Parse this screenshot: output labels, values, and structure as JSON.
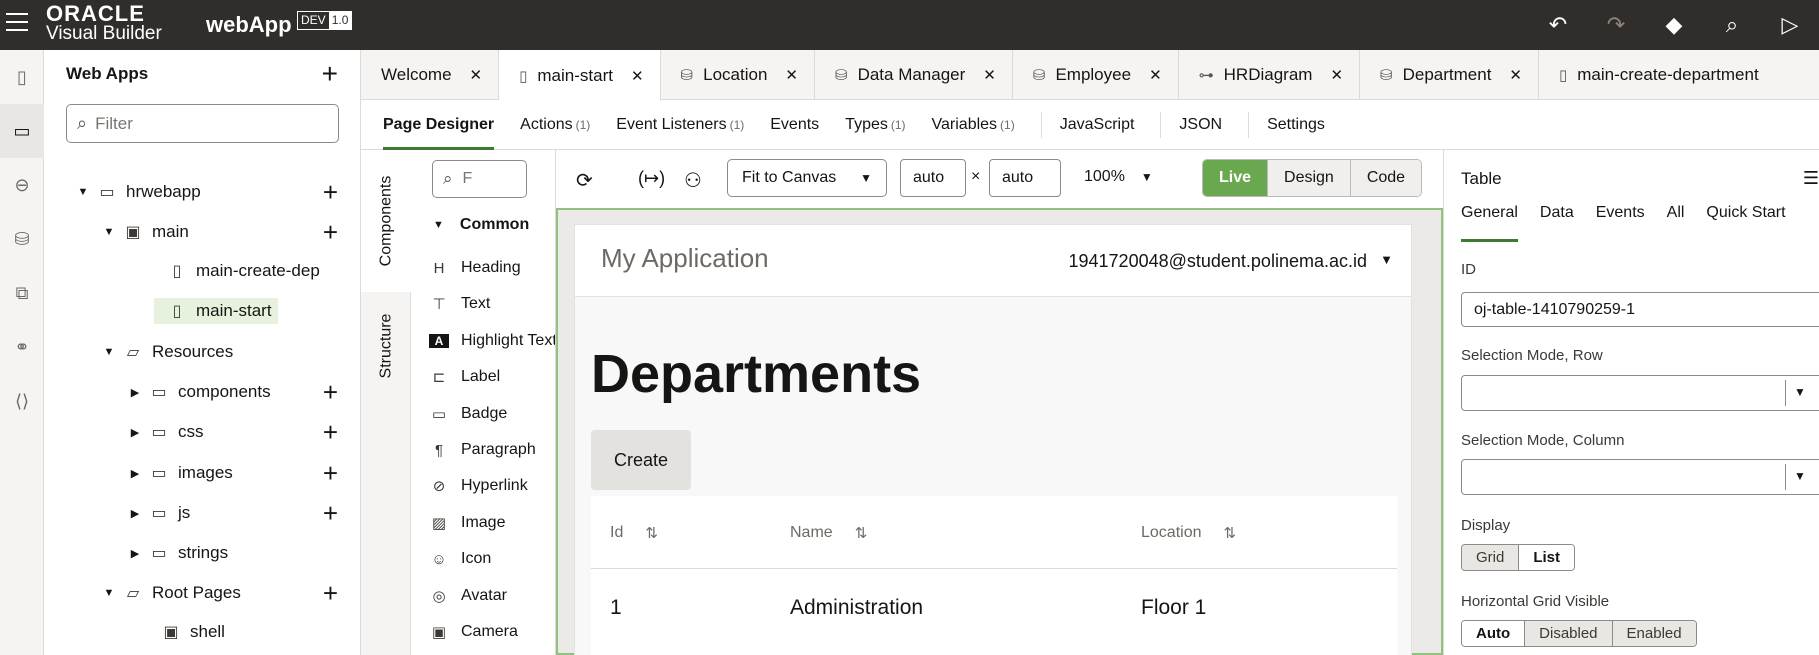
{
  "topbar": {
    "logo_top": "ORACLE",
    "logo_bottom": "Visual Builder",
    "app_name": "webApp",
    "env": "DEV",
    "version": "1.0",
    "icons": [
      "undo-icon",
      "redo-icon",
      "git-icon",
      "search-icon",
      "run-icon"
    ]
  },
  "rail": {
    "icons": [
      "mobile-apps-icon",
      "web-apps-icon",
      "services-icon",
      "business-objects-icon",
      "components-icon",
      "processes-icon",
      "source-icon"
    ],
    "active_index": 1
  },
  "navigator": {
    "title": "Web Apps",
    "filter_placeholder": "Filter",
    "tree": [
      {
        "label": "hrwebapp",
        "depth": 0,
        "expanded": true,
        "icon": "monitor-icon",
        "add": true
      },
      {
        "label": "main",
        "depth": 1,
        "expanded": true,
        "icon": "flow-icon",
        "add": true
      },
      {
        "label": "main-create-dep",
        "depth": 2,
        "icon": "page-icon",
        "add": false
      },
      {
        "label": "main-start",
        "depth": 2,
        "icon": "page-icon",
        "add": false,
        "selected": true
      },
      {
        "label": "Resources",
        "depth": 1,
        "expanded": true,
        "icon": "folder-open-icon",
        "add": false
      },
      {
        "label": "components",
        "depth": 2,
        "expanded": false,
        "icon": "folder-icon",
        "add": true
      },
      {
        "label": "css",
        "depth": 2,
        "expanded": false,
        "icon": "folder-icon",
        "add": true
      },
      {
        "label": "images",
        "depth": 2,
        "expanded": false,
        "icon": "folder-icon",
        "add": true
      },
      {
        "label": "js",
        "depth": 2,
        "expanded": false,
        "icon": "folder-icon",
        "add": true
      },
      {
        "label": "strings",
        "depth": 2,
        "expanded": false,
        "icon": "folder-icon",
        "add": false
      },
      {
        "label": "Root Pages",
        "depth": 1,
        "expanded": true,
        "icon": "folder-open-icon",
        "add": true
      },
      {
        "label": "shell",
        "depth": 2,
        "icon": "shell-icon",
        "add": false
      }
    ]
  },
  "tabs": [
    {
      "label": "Welcome",
      "icon": ""
    },
    {
      "label": "main-start",
      "icon": "page-icon",
      "active": true
    },
    {
      "label": "Location",
      "icon": "database-icon"
    },
    {
      "label": "Data Manager",
      "icon": "database-icon"
    },
    {
      "label": "Employee",
      "icon": "database-icon"
    },
    {
      "label": "HRDiagram",
      "icon": "diagram-icon"
    },
    {
      "label": "Department",
      "icon": "database-icon"
    },
    {
      "label": "main-create-department",
      "icon": "page-icon"
    }
  ],
  "subtabs": [
    {
      "label": "Page Designer",
      "count": "",
      "active": true
    },
    {
      "label": "Actions",
      "count": "(1)"
    },
    {
      "label": "Event Listeners",
      "count": "(1)"
    },
    {
      "label": "Events",
      "count": ""
    },
    {
      "label": "Types",
      "count": "(1)"
    },
    {
      "label": "Variables",
      "count": "(1)"
    },
    {
      "label": "JavaScript",
      "count": ""
    },
    {
      "label": "JSON",
      "count": ""
    },
    {
      "label": "Settings",
      "count": ""
    }
  ],
  "side_tabs": {
    "components": "Components",
    "structure": "Structure"
  },
  "palette": {
    "search_placeholder": "F",
    "category": "Common",
    "items": [
      {
        "label": "Heading",
        "icon": "heading-icon"
      },
      {
        "label": "Text",
        "icon": "text-icon"
      },
      {
        "label": "Highlight Text",
        "icon": "highlight-text-icon"
      },
      {
        "label": "Label",
        "icon": "label-icon"
      },
      {
        "label": "Badge",
        "icon": "badge-icon"
      },
      {
        "label": "Paragraph",
        "icon": "paragraph-icon"
      },
      {
        "label": "Hyperlink",
        "icon": "hyperlink-icon"
      },
      {
        "label": "Image",
        "icon": "image-icon"
      },
      {
        "label": "Icon",
        "icon": "icon-icon"
      },
      {
        "label": "Avatar",
        "icon": "avatar-icon"
      },
      {
        "label": "Camera",
        "icon": "camera-icon"
      }
    ]
  },
  "toolbar": {
    "fit": "Fit to Canvas",
    "width": "auto",
    "height": "auto",
    "times": "×",
    "zoom": "100%",
    "modes": [
      "Live",
      "Design",
      "Code"
    ],
    "active_mode": "Live"
  },
  "canvas": {
    "app_title": "My Application",
    "user": "1941720048@student.polinema.ac.id",
    "heading": "Departments",
    "create_label": "Create",
    "table": {
      "columns": [
        "Id",
        "Name",
        "Location"
      ],
      "rows": [
        [
          "1",
          "Administration",
          "Floor 1"
        ]
      ]
    }
  },
  "props": {
    "title": "Table",
    "tabs": [
      "General",
      "Data",
      "Events",
      "All",
      "Quick Start"
    ],
    "active_tab": "General",
    "id_label": "ID",
    "id_value": "oj-table-1410790259-1",
    "sel_row_label": "Selection Mode, Row",
    "sel_col_label": "Selection Mode, Column",
    "display_label": "Display",
    "display_options": [
      "Grid",
      "List"
    ],
    "display_active": "List",
    "hgrid_label": "Horizontal Grid Visible",
    "hgrid_options": [
      "Auto",
      "Disabled",
      "Enabled"
    ],
    "hgrid_active": "Auto"
  },
  "colors": {
    "topbar": "#312d2a",
    "accent": "#6aa84f",
    "tab_underline": "#3d7a31"
  }
}
